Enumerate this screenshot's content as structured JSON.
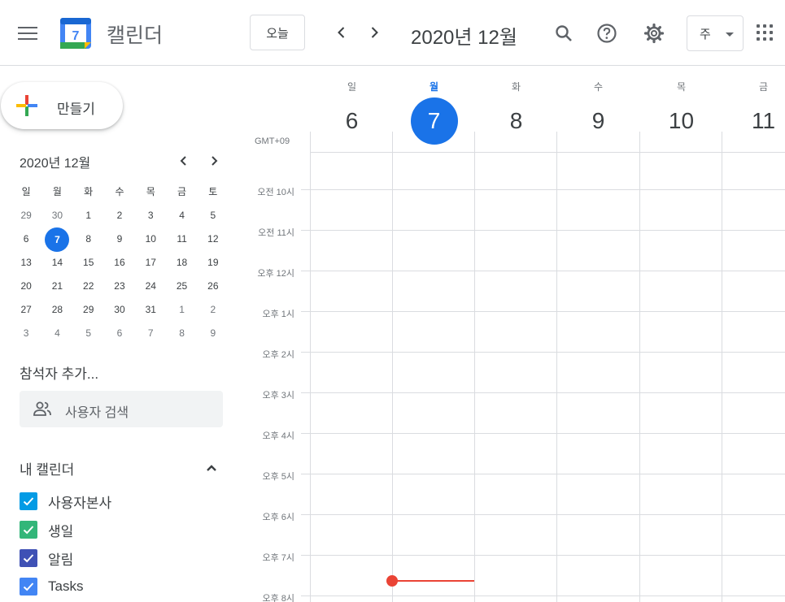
{
  "header": {
    "app_title": "캘린더",
    "logo_day": "7",
    "today_label": "오늘",
    "current_range": "2020년 12월",
    "view_label": "주"
  },
  "sidebar": {
    "create_label": "만들기",
    "mini_calendar": {
      "title": "2020년 12월",
      "weekdays": [
        "일",
        "월",
        "화",
        "수",
        "목",
        "금",
        "토"
      ],
      "weeks": [
        [
          "29",
          "30",
          "1",
          "2",
          "3",
          "4",
          "5"
        ],
        [
          "6",
          "7",
          "8",
          "9",
          "10",
          "11",
          "12"
        ],
        [
          "13",
          "14",
          "15",
          "16",
          "17",
          "18",
          "19"
        ],
        [
          "20",
          "21",
          "22",
          "23",
          "24",
          "25",
          "26"
        ],
        [
          "27",
          "28",
          "29",
          "30",
          "31",
          "1",
          "2"
        ],
        [
          "3",
          "4",
          "5",
          "6",
          "7",
          "8",
          "9"
        ]
      ],
      "selected_day": "7"
    },
    "guests_label": "참석자 추가...",
    "search_people_placeholder": "사용자 검색",
    "my_calendars_title": "내 캘린더",
    "calendars": [
      {
        "name": "사용자본사",
        "color": "#039be5"
      },
      {
        "name": "생일",
        "color": "#33b679"
      },
      {
        "name": "알림",
        "color": "#3f51b5"
      },
      {
        "name": "Tasks",
        "color": "#4285f4"
      }
    ]
  },
  "week": {
    "days": [
      {
        "dow": "일",
        "num": "6"
      },
      {
        "dow": "월",
        "num": "7",
        "today": true
      },
      {
        "dow": "화",
        "num": "8"
      },
      {
        "dow": "수",
        "num": "9"
      },
      {
        "dow": "목",
        "num": "10"
      },
      {
        "dow": "금",
        "num": "11"
      }
    ],
    "timezone": "GMT+09",
    "hours": [
      "오전 10시",
      "오전 11시",
      "오후 12시",
      "오후 1시",
      "오후 2시",
      "오후 3시",
      "오후 4시",
      "오후 5시",
      "오후 6시",
      "오후 7시",
      "오후 8시"
    ]
  },
  "colors": {
    "accent": "#1a73e8",
    "now_indicator": "#ea4335"
  }
}
